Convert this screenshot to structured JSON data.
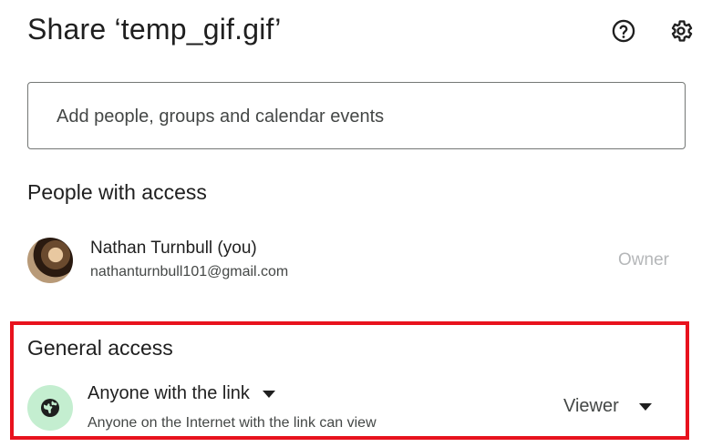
{
  "dialog": {
    "title": "Share ‘temp_gif.gif’",
    "help_icon": "help-circle-icon",
    "settings_icon": "gear-icon"
  },
  "search": {
    "placeholder": "Add people, groups and calendar events",
    "value": ""
  },
  "people_with_access": {
    "heading": "People with access",
    "people": [
      {
        "name": "Nathan Turnbull (you)",
        "email": "nathanturnbull101@gmail.com",
        "role": "Owner"
      }
    ]
  },
  "general_access": {
    "heading": "General access",
    "icon": "globe-icon",
    "option": "Anyone with the link",
    "description": "Anyone on the Internet with the link can view",
    "role": "Viewer"
  },
  "colors": {
    "highlight_border": "#e8121d",
    "globe_badge_bg": "#c4eed0",
    "owner_text": "#b5b7b9"
  }
}
